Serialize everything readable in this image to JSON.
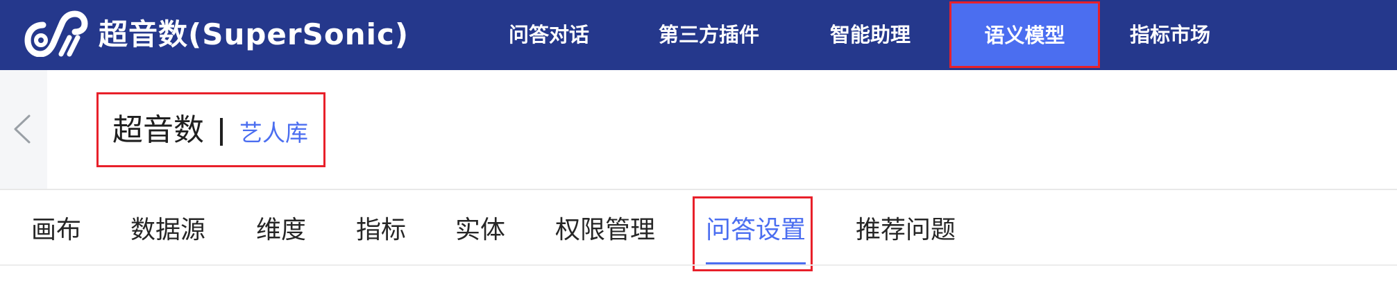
{
  "header": {
    "brand": "超音数(SuperSonic)",
    "logo_icon": "supersonic-logo-icon",
    "nav": [
      {
        "label": "问答对话"
      },
      {
        "label": "第三方插件"
      },
      {
        "label": "智能助理"
      },
      {
        "label": "语义模型",
        "active": true
      },
      {
        "label": "指标市场"
      }
    ]
  },
  "subheader": {
    "back_icon": "chevron-left-icon",
    "domain": "超音数",
    "model": "艺人库"
  },
  "tabs": [
    {
      "label": "画布"
    },
    {
      "label": "数据源"
    },
    {
      "label": "维度"
    },
    {
      "label": "指标"
    },
    {
      "label": "实体"
    },
    {
      "label": "权限管理"
    },
    {
      "label": "问答设置",
      "active": true
    },
    {
      "label": "推荐问题"
    }
  ],
  "colors": {
    "nav_bg": "#25388c",
    "accent": "#4b6ef0",
    "highlight": "#e8202a"
  }
}
